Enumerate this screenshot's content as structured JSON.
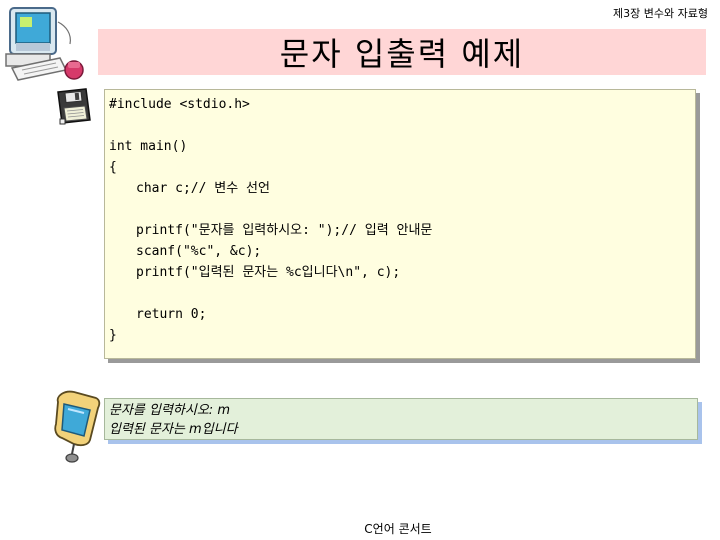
{
  "header": {
    "chapter": "제3장 변수와 자료형",
    "title": "문자 입출력 예제"
  },
  "code": {
    "lines": [
      "#include <stdio.h>",
      "",
      "int main()",
      "{",
      "char c;// 변수 선언",
      "",
      "printf(\"문자를 입력하시오: \");// 입력 안내문",
      "scanf(\"%c\", &c);",
      "printf(\"입력된 문자는 %c입니다\\n\", c);",
      "",
      "return 0;",
      "}"
    ]
  },
  "output": {
    "lines": [
      "문자를 입력하시오: m",
      "입력된 문자는 m입니다"
    ]
  },
  "footer": {
    "text": "C언어 콘서트"
  },
  "icons": {
    "computer": "computer-clipart-icon",
    "floppy": "floppy-disk-icon",
    "monitor": "monitor-clipart-icon"
  }
}
